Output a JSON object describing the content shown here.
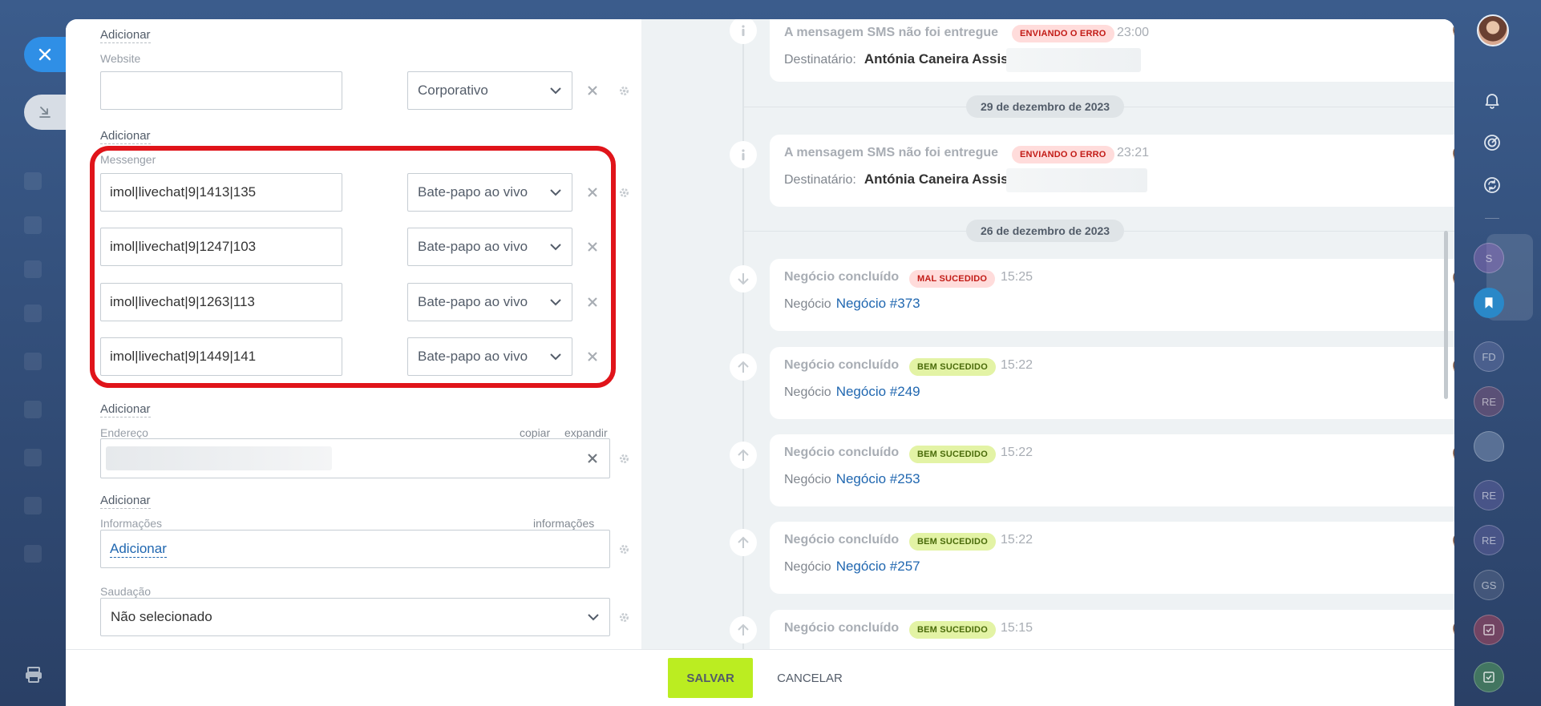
{
  "footer": {
    "save_label": "SALVAR",
    "cancel_label": "CANCELAR"
  },
  "form": {
    "website": {
      "add_label_top": "Adicionar",
      "label": "Website",
      "value": "",
      "type": "Corporativo",
      "add_label": "Adicionar"
    },
    "messenger": {
      "label": "Messenger",
      "rows": [
        {
          "value": "imol|livechat|9|1413|135",
          "type": "Bate-papo ao vivo"
        },
        {
          "value": "imol|livechat|9|1247|103",
          "type": "Bate-papo ao vivo"
        },
        {
          "value": "imol|livechat|9|1263|113",
          "type": "Bate-papo ao vivo"
        },
        {
          "value": "imol|livechat|9|1449|141",
          "type": "Bate-papo ao vivo"
        }
      ],
      "add_label": "Adicionar"
    },
    "address": {
      "label": "Endereço",
      "copy_label": "copiar",
      "expand_label": "expandir",
      "add_label": "Adicionar"
    },
    "info": {
      "label": "Informações",
      "right_label": "informações",
      "link_label": "Adicionar"
    },
    "greeting": {
      "label": "Saudação",
      "value": "Não selecionado"
    }
  },
  "timeline": {
    "dates": [
      "29 de dezembro de 2023",
      "26 de dezembro de 2023"
    ],
    "sms_events": [
      {
        "title": "A mensagem SMS não foi entregue",
        "badge": "ENVIANDO O ERRO",
        "time": "23:00",
        "recipient_label": "Destinatário:",
        "recipient": "Antónia Caneira Assis"
      },
      {
        "title": "A mensagem SMS não foi entregue",
        "badge": "ENVIANDO O ERRO",
        "time": "23:21",
        "recipient_label": "Destinatário:",
        "recipient": "Antónia Caneira Assis"
      }
    ],
    "deal_events": [
      {
        "title": "Negócio concluído",
        "badge": "MAL SUCEDIDO",
        "badge_kind": "error",
        "time": "15:25",
        "label": "Negócio",
        "link": "Negócio #373"
      },
      {
        "title": "Negócio concluído",
        "badge": "BEM SUCEDIDO",
        "badge_kind": "success",
        "time": "15:22",
        "label": "Negócio",
        "link": "Negócio #249"
      },
      {
        "title": "Negócio concluído",
        "badge": "BEM SUCEDIDO",
        "badge_kind": "success",
        "time": "15:22",
        "label": "Negócio",
        "link": "Negócio #253"
      },
      {
        "title": "Negócio concluído",
        "badge": "BEM SUCEDIDO",
        "badge_kind": "success",
        "time": "15:22",
        "label": "Negócio",
        "link": "Negócio #257"
      },
      {
        "title": "Negócio concluído",
        "badge": "BEM SUCEDIDO",
        "badge_kind": "success",
        "time": "15:15"
      }
    ]
  },
  "right_rail": {
    "avatars": [
      "S",
      "FD",
      "RE",
      "RE",
      "RE",
      "GS"
    ]
  },
  "colors": {
    "accent": "#2f8fe6",
    "save_button": "#bbed21",
    "highlight": "#e0141a",
    "link": "#2067b0"
  }
}
